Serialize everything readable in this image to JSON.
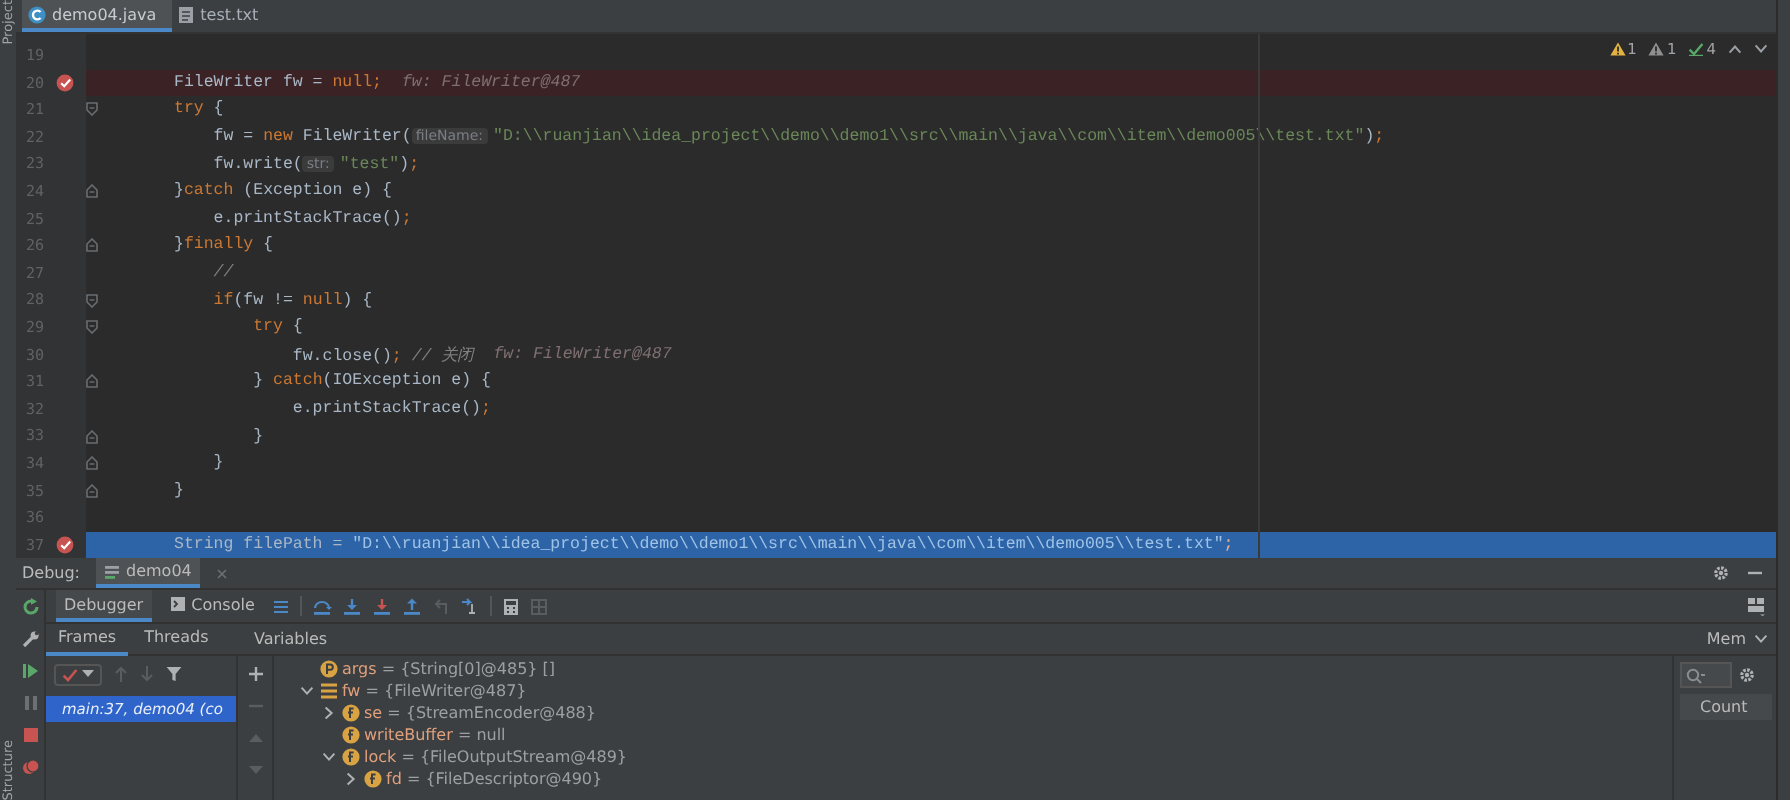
{
  "side_labels": {
    "top": "Project",
    "bottom": "Structure"
  },
  "editor_tabs": [
    {
      "label": "demo04.java",
      "kind": "java",
      "selected": true
    },
    {
      "label": "test.txt",
      "kind": "text",
      "selected": false
    }
  ],
  "inspections": [
    {
      "kind": "warning",
      "count": "1"
    },
    {
      "kind": "weak_warning",
      "count": "1"
    },
    {
      "kind": "typo",
      "count": "4"
    }
  ],
  "code_lines": [
    {
      "number": "19",
      "current": false,
      "breakpoint": false,
      "fold_start": false,
      "fold_end": false
    },
    {
      "number": "20",
      "current": false,
      "breakpoint": true,
      "fold_start": false,
      "fold_end": false,
      "tokens": [
        {
          "kind": "plain",
          "t": "FileWriter fw = "
        },
        {
          "kind": "kw",
          "t": "null"
        },
        {
          "kind": "kw",
          "t": ";"
        }
      ],
      "inline_value": "fw: FileWriter@487"
    },
    {
      "number": "21",
      "current": false,
      "breakpoint": false,
      "fold_start": true,
      "fold_end": false,
      "tokens": [
        {
          "kind": "kw",
          "t": "try"
        },
        {
          "kind": "plain",
          "t": " {"
        }
      ]
    },
    {
      "number": "22",
      "current": false,
      "breakpoint": false,
      "fold_start": false,
      "fold_end": false,
      "tokens": [
        {
          "kind": "plain",
          "t": "    fw = "
        },
        {
          "kind": "kw",
          "t": "new"
        },
        {
          "kind": "plain",
          "t": " FileWriter("
        },
        {
          "kind": "hint",
          "t": "fileName:"
        },
        {
          "kind": "str",
          "t": "\"D:\\\\ruanjian\\\\idea_project\\\\demo\\\\demo1\\\\src\\\\main\\\\java\\\\com\\\\item\\\\demo005\\\\test.txt\""
        },
        {
          "kind": "plain",
          "t": ")"
        },
        {
          "kind": "kw",
          "t": ";"
        }
      ]
    },
    {
      "number": "23",
      "current": false,
      "breakpoint": false,
      "fold_start": false,
      "fold_end": false,
      "tokens": [
        {
          "kind": "plain",
          "t": "    fw.write("
        },
        {
          "kind": "hint",
          "t": "str:"
        },
        {
          "kind": "str",
          "t": "\"test\""
        },
        {
          "kind": "plain",
          "t": ")"
        },
        {
          "kind": "kw",
          "t": ";"
        }
      ]
    },
    {
      "number": "24",
      "current": false,
      "breakpoint": false,
      "fold_start": false,
      "fold_end": true,
      "tokens": [
        {
          "kind": "plain",
          "t": "}"
        },
        {
          "kind": "kw",
          "t": "catch"
        },
        {
          "kind": "plain",
          "t": " (Exception e) {"
        }
      ]
    },
    {
      "number": "25",
      "current": false,
      "breakpoint": false,
      "fold_start": false,
      "fold_end": false,
      "tokens": [
        {
          "kind": "plain",
          "t": "    e.printStackTrace()"
        },
        {
          "kind": "kw",
          "t": ";"
        }
      ]
    },
    {
      "number": "26",
      "current": false,
      "breakpoint": false,
      "fold_start": false,
      "fold_end": true,
      "tokens": [
        {
          "kind": "plain",
          "t": "}"
        },
        {
          "kind": "kw",
          "t": "finally"
        },
        {
          "kind": "plain",
          "t": " {"
        }
      ]
    },
    {
      "number": "27",
      "current": false,
      "breakpoint": false,
      "fold_start": false,
      "fold_end": false,
      "tokens": [
        {
          "kind": "comment",
          "t": "    //"
        }
      ]
    },
    {
      "number": "28",
      "current": false,
      "breakpoint": false,
      "fold_start": true,
      "fold_end": false,
      "tokens": [
        {
          "kind": "kw",
          "t": "    if"
        },
        {
          "kind": "plain",
          "t": "(fw != "
        },
        {
          "kind": "kw",
          "t": "null"
        },
        {
          "kind": "plain",
          "t": ") {"
        }
      ]
    },
    {
      "number": "29",
      "current": false,
      "breakpoint": false,
      "fold_start": true,
      "fold_end": false,
      "tokens": [
        {
          "kind": "kw",
          "t": "        try"
        },
        {
          "kind": "plain",
          "t": " {"
        }
      ]
    },
    {
      "number": "30",
      "current": false,
      "breakpoint": false,
      "fold_start": false,
      "fold_end": false,
      "tokens": [
        {
          "kind": "plain",
          "t": "            fw.close()"
        },
        {
          "kind": "kw",
          "t": ";"
        },
        {
          "kind": "comment",
          "t": " // 关闭"
        }
      ],
      "inline_value": "fw: FileWriter@487"
    },
    {
      "number": "31",
      "current": false,
      "breakpoint": false,
      "fold_start": false,
      "fold_end": true,
      "tokens": [
        {
          "kind": "plain",
          "t": "        } "
        },
        {
          "kind": "kw",
          "t": "catch"
        },
        {
          "kind": "plain",
          "t": "(IOException e) {"
        }
      ]
    },
    {
      "number": "32",
      "current": false,
      "breakpoint": false,
      "fold_start": false,
      "fold_end": false,
      "tokens": [
        {
          "kind": "plain",
          "t": "            e.printStackTrace()"
        },
        {
          "kind": "kw",
          "t": ";"
        }
      ]
    },
    {
      "number": "33",
      "current": false,
      "breakpoint": false,
      "fold_start": false,
      "fold_end": true,
      "tokens": [
        {
          "kind": "plain",
          "t": "        }"
        }
      ]
    },
    {
      "number": "34",
      "current": false,
      "breakpoint": false,
      "fold_start": false,
      "fold_end": true,
      "tokens": [
        {
          "kind": "plain",
          "t": "    }"
        }
      ]
    },
    {
      "number": "35",
      "current": false,
      "breakpoint": false,
      "fold_start": false,
      "fold_end": true,
      "tokens": [
        {
          "kind": "plain",
          "t": "}"
        }
      ]
    },
    {
      "number": "36",
      "current": false,
      "breakpoint": false,
      "fold_start": false,
      "fold_end": false
    },
    {
      "number": "37",
      "current": true,
      "breakpoint": true,
      "fold_start": false,
      "fold_end": false,
      "tokens": [
        {
          "kind": "plain",
          "t": "String filePath = "
        },
        {
          "kind": "str",
          "t": "\"D:\\\\ruanjian\\\\idea_project\\\\demo\\\\demo1\\\\src\\\\main\\\\java\\\\com\\\\item\\\\demo005\\\\test.txt\""
        },
        {
          "kind": "kw",
          "t": ";"
        }
      ]
    }
  ],
  "debug": {
    "label": "Debug:",
    "session_tab": "demo04",
    "tabs": [
      {
        "label": "Debugger",
        "kind": "debugger",
        "selected": true
      },
      {
        "label": "Console",
        "kind": "console",
        "selected": false
      }
    ],
    "frame_tabs": [
      {
        "label": "Frames",
        "selected": true
      },
      {
        "label": "Threads",
        "selected": false
      }
    ],
    "variables_title": "Variables",
    "frames": [
      {
        "label": "main:37, demo04 (co",
        "selected": true
      }
    ],
    "variables": [
      {
        "name": "args",
        "value": " = {String[0]@485} []",
        "kind": "param",
        "expandable": false
      },
      {
        "name": "fw",
        "value": " = {FileWriter@487}",
        "kind": "object",
        "expandable": true,
        "expanded": true,
        "children": [
          {
            "name": "se",
            "value": " = {StreamEncoder@488}",
            "kind": "field",
            "expandable": true,
            "expanded": false
          },
          {
            "name": "writeBuffer",
            "value": " = null",
            "kind": "field",
            "expandable": false
          },
          {
            "name": "lock",
            "value": " = {FileOutputStream@489}",
            "kind": "field",
            "expandable": true,
            "expanded": true,
            "children": [
              {
                "name": "fd",
                "value": " = {FileDescriptor@490}",
                "kind": "field",
                "expandable": true,
                "expanded": false
              }
            ]
          }
        ]
      }
    ],
    "memory": {
      "dropdown": "Mem",
      "column": "Count"
    }
  }
}
